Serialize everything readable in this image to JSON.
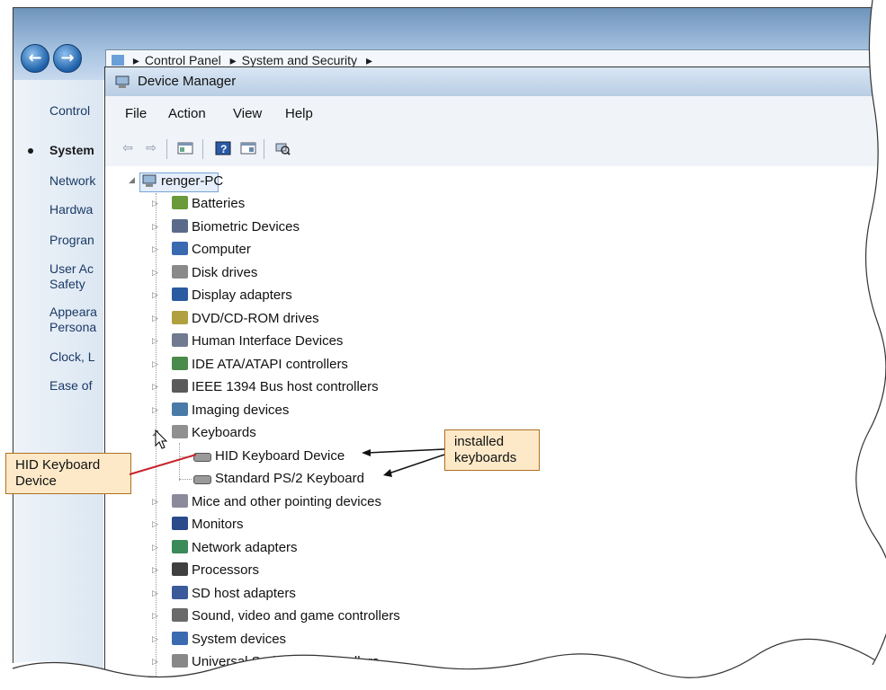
{
  "control_panel": {
    "breadcrumb": [
      "Control Panel",
      "System and Security"
    ],
    "sidebar": [
      "Control",
      "System",
      "Network",
      "Hardwa",
      "Progran",
      "User Ac\nSafety",
      "Appeara\nPersona",
      "Clock, L",
      "Ease of"
    ]
  },
  "device_manager": {
    "title": "Device Manager",
    "menu": [
      "File",
      "Action",
      "View",
      "Help"
    ],
    "root": "renger-PC",
    "categories": [
      "Batteries",
      "Biometric Devices",
      "Computer",
      "Disk drives",
      "Display adapters",
      "DVD/CD-ROM drives",
      "Human Interface Devices",
      "IDE ATA/ATAPI controllers",
      "IEEE 1394 Bus host controllers",
      "Imaging devices",
      "Keyboards"
    ],
    "keyboards": [
      "HID Keyboard Device",
      "Standard PS/2 Keyboard"
    ],
    "categories_after": [
      "Mice and other pointing devices",
      "Monitors",
      "Network adapters",
      "Processors",
      "SD host adapters",
      "Sound, video and game controllers",
      "System devices",
      "Universal Serial Bus controllers"
    ]
  },
  "callouts": {
    "left": "HID Keyboard Device",
    "right": "installed keyboards"
  }
}
